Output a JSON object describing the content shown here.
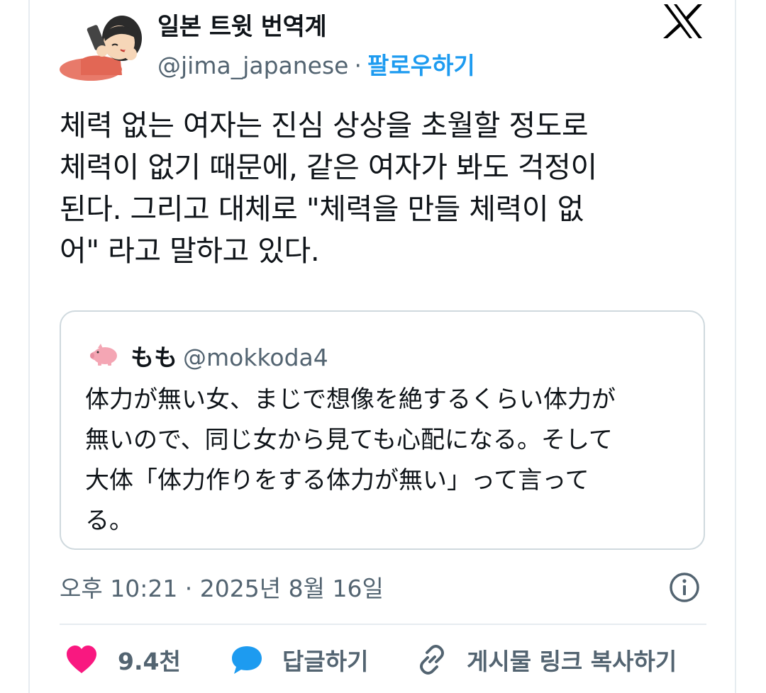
{
  "author": {
    "display_name": "일본 트윗 번역계",
    "handle": "@jima_japanese",
    "separator": "·",
    "follow_label": "팔로우하기"
  },
  "tweet": {
    "lines": [
      "체력 없는 여자는 진심 상상을 초월할 정도로",
      "체력이 없기 때문에, 같은 여자가 봐도 걱정이",
      "된다. 그리고 대체로 \"체력을 만들 체력이 없",
      "어\" 라고 말하고 있다."
    ]
  },
  "quote": {
    "name": "もも",
    "handle": "@mokkoda4",
    "lines": [
      "体力が無い女、まじで想像を絶するくらい体力が",
      "無いので、同じ女から見ても心配になる。そして",
      "大体「体力作りをする体力が無い」って言って",
      "る。"
    ]
  },
  "timestamp": "오후 10:21 · 2025년 8월 16일",
  "actions": {
    "like_count": "9.4천",
    "reply_label": "답글하기",
    "copy_link_label": "게시물 링크 복사하기"
  },
  "colors": {
    "accent": "#1d9bf0",
    "like": "#f91880",
    "secondary_text": "#536471",
    "border": "#cfd9de"
  },
  "icons": [
    "x-logo-icon",
    "info-icon",
    "heart-icon",
    "speech-bubble-icon",
    "link-icon",
    "pig-icon"
  ]
}
